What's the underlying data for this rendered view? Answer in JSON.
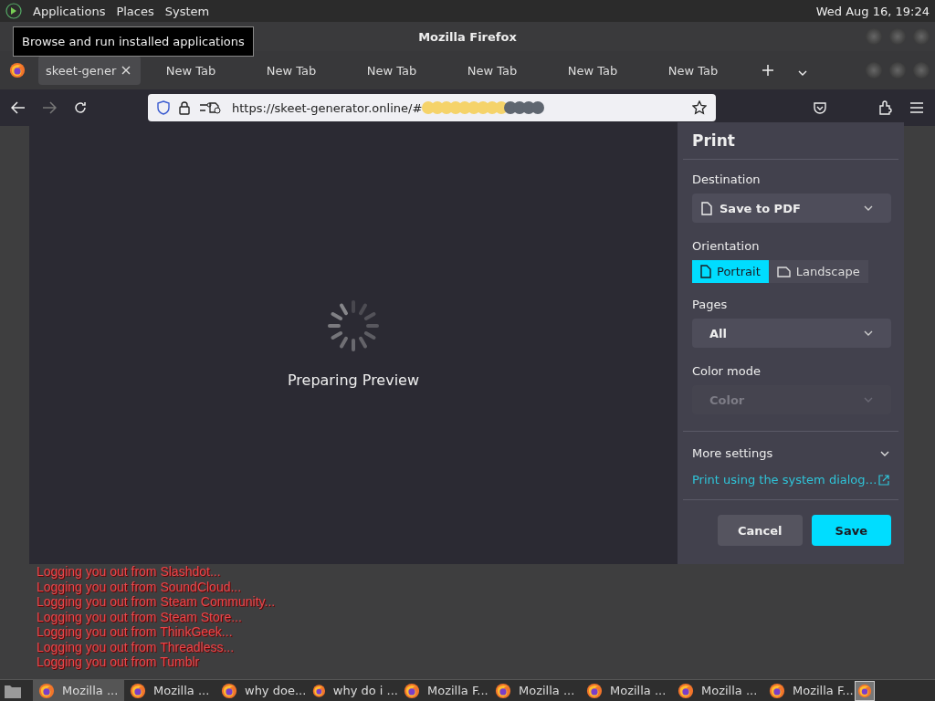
{
  "top_panel": {
    "menus": [
      "Applications",
      "Places",
      "System"
    ],
    "clock": "Wed Aug 16, 19:24"
  },
  "tooltip": "Browse and run installed applications",
  "window": {
    "title": "Mozilla Firefox"
  },
  "tabs": [
    {
      "label": "skeet-gener",
      "selected": true
    },
    {
      "label": "New Tab",
      "selected": false
    },
    {
      "label": "New Tab",
      "selected": false
    },
    {
      "label": "New Tab",
      "selected": false
    },
    {
      "label": "New Tab",
      "selected": false
    },
    {
      "label": "New Tab",
      "selected": false
    },
    {
      "label": "New Tab",
      "selected": false
    }
  ],
  "address_bar": {
    "url": "https://skeet-generator.online/#"
  },
  "preview": {
    "status": "Preparing Preview"
  },
  "print": {
    "title": "Print",
    "destination": {
      "label": "Destination",
      "value": "Save to PDF"
    },
    "orientation": {
      "label": "Orientation",
      "options": [
        {
          "label": "Portrait",
          "selected": true
        },
        {
          "label": "Landscape",
          "selected": false
        }
      ]
    },
    "pages": {
      "label": "Pages",
      "value": "All"
    },
    "color_mode": {
      "label": "Color mode",
      "value": "Color",
      "disabled": true
    },
    "more_settings": {
      "label": "More settings",
      "expanded": false
    },
    "system_dialog_link": "Print using the system dialog…",
    "buttons": [
      "Cancel",
      "Save"
    ]
  },
  "log_lines": [
    "Logging you out from Slashdot...",
    "Logging you out from SoundCloud...",
    "Logging you out from Steam Community...",
    "Logging you out from Steam Store...",
    "Logging you out from ThinkGeek...",
    "Logging you out from Threadless...",
    "Logging you out from Tumblr"
  ],
  "taskbar": [
    {
      "label": "Mozilla ...",
      "selected": true
    },
    {
      "label": "Mozilla ...",
      "selected": false
    },
    {
      "label": "why doe...",
      "selected": false
    },
    {
      "label": "why do i ...",
      "selected": false
    },
    {
      "label": "Mozilla F...",
      "selected": false
    },
    {
      "label": "Mozilla ...",
      "selected": false
    },
    {
      "label": "Mozilla ...",
      "selected": false
    },
    {
      "label": "Mozilla ...",
      "selected": false
    },
    {
      "label": "Mozilla F...",
      "selected": false
    }
  ]
}
